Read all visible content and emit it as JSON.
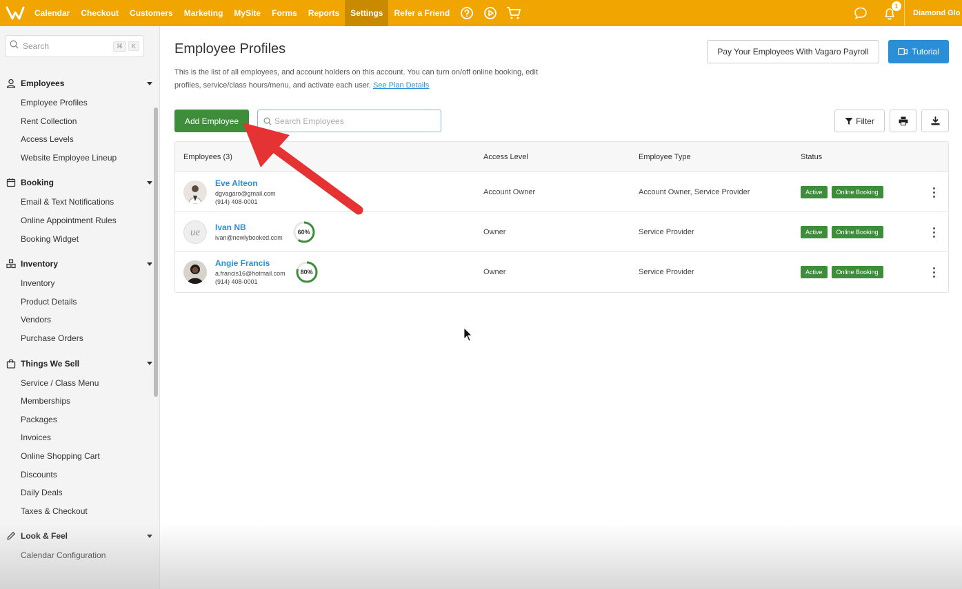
{
  "nav": {
    "items": [
      {
        "label": "Calendar",
        "active": false
      },
      {
        "label": "Checkout",
        "active": false
      },
      {
        "label": "Customers",
        "active": false
      },
      {
        "label": "Marketing",
        "active": false
      },
      {
        "label": "MySite",
        "active": false
      },
      {
        "label": "Forms",
        "active": false
      },
      {
        "label": "Reports",
        "active": false
      },
      {
        "label": "Settings",
        "active": true
      },
      {
        "label": "Refer a Friend",
        "active": false
      }
    ],
    "notification_count": "1",
    "account_name": "Diamond Glo",
    "accent": "#f0a500"
  },
  "sidebar": {
    "search_placeholder": "Search",
    "shortcut_cmd": "⌘",
    "shortcut_key": "K",
    "sections": [
      {
        "title": "Employees",
        "icon": "person-icon",
        "items": [
          "Employee Profiles",
          "Rent Collection",
          "Access Levels",
          "Website Employee Lineup"
        ]
      },
      {
        "title": "Booking",
        "icon": "calendar-icon",
        "items": [
          "Email & Text Notifications",
          "Online Appointment Rules",
          "Booking Widget"
        ]
      },
      {
        "title": "Inventory",
        "icon": "boxes-icon",
        "items": [
          "Inventory",
          "Product Details",
          "Vendors",
          "Purchase Orders"
        ]
      },
      {
        "title": "Things We Sell",
        "icon": "bag-icon",
        "items": [
          "Service / Class Menu",
          "Memberships",
          "Packages",
          "Invoices",
          "Online Shopping Cart",
          "Discounts",
          "Daily Deals",
          "Taxes & Checkout"
        ]
      },
      {
        "title": "Look & Feel",
        "icon": "pencil-icon",
        "items": [
          "Calendar Configuration"
        ]
      }
    ]
  },
  "main": {
    "title": "Employee Profiles",
    "description": "This is the list of all employees, and account holders on this account. You can turn on/off online booking, edit profiles, service/class hours/menu, and activate each user.",
    "plan_link": "See Plan Details",
    "payroll_button": "Pay Your Employees With Vagaro Payroll",
    "tutorial_button": "Tutorial",
    "add_button": "Add Employee",
    "search_placeholder": "Search Employees",
    "filter_button": "Filter",
    "table": {
      "headers": [
        "Employees (3)",
        "Access Level",
        "Employee Type",
        "Status"
      ],
      "rows": [
        {
          "name": "Eve Alteon",
          "email": "dgvagaro@gmail.com",
          "phone": "(914) 408-0001",
          "progress": "",
          "access": "Account Owner",
          "type": "Account Owner, Service Provider",
          "status": [
            "Active",
            "Online Booking"
          ]
        },
        {
          "name": "Ivan NB",
          "email": "ivan@newlybooked.com",
          "phone": "",
          "progress": "60%",
          "access": "Owner",
          "type": "Service Provider",
          "status": [
            "Active",
            "Online Booking"
          ]
        },
        {
          "name": "Angie Francis",
          "email": "a.francis16@hotmail.com",
          "phone": "(914) 408-0001",
          "progress": "80%",
          "access": "Owner",
          "type": "Service Provider",
          "status": [
            "Active",
            "Online Booking"
          ]
        }
      ]
    }
  }
}
